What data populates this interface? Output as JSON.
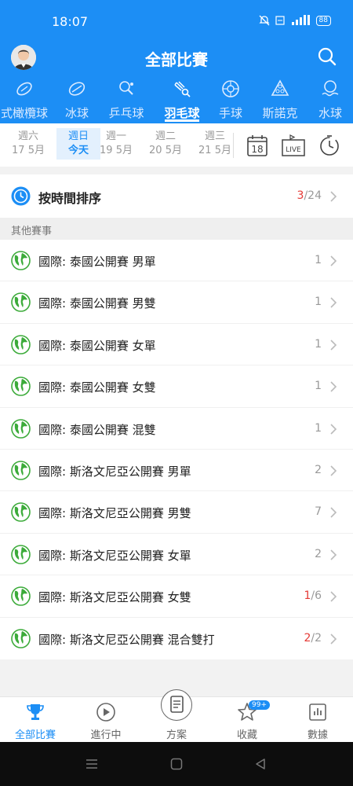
{
  "status_bar": {
    "time": "18:07",
    "battery": "88"
  },
  "header": {
    "title": "全部比賽"
  },
  "sport_tabs": [
    {
      "label": "式橄欖球",
      "icon": "rugby-ball-icon",
      "active": false
    },
    {
      "label": "冰球",
      "icon": "hockey-puck-icon",
      "active": false
    },
    {
      "label": "乒乓球",
      "icon": "table-tennis-icon",
      "active": false
    },
    {
      "label": "羽毛球",
      "icon": "badminton-icon",
      "active": true
    },
    {
      "label": "手球",
      "icon": "handball-icon",
      "active": false
    },
    {
      "label": "斯諾克",
      "icon": "snooker-icon",
      "active": false
    },
    {
      "label": "水球",
      "icon": "water-polo-icon",
      "active": false
    }
  ],
  "dates": [
    {
      "top": "週六",
      "bottom": "17 5月",
      "active": false
    },
    {
      "top": "週日",
      "bottom": "今天",
      "active": true
    },
    {
      "top": "週一",
      "bottom": "19 5月",
      "active": false
    },
    {
      "top": "週二",
      "bottom": "20 5月",
      "active": false
    },
    {
      "top": "週三",
      "bottom": "21 5月",
      "active": false
    }
  ],
  "tools": {
    "calendar_day": "18",
    "live_label": "LIVE"
  },
  "sort_row": {
    "label": "按時間排序",
    "count_highlight": "3",
    "count_rest": "/24"
  },
  "section": {
    "title": "其他賽事"
  },
  "leagues": [
    {
      "name": "國際: 泰國公開賽 男單",
      "count_highlight": "",
      "count_rest": "1"
    },
    {
      "name": "國際: 泰國公開賽 男雙",
      "count_highlight": "",
      "count_rest": "1"
    },
    {
      "name": "國際: 泰國公開賽 女單",
      "count_highlight": "",
      "count_rest": "1"
    },
    {
      "name": "國際: 泰國公開賽 女雙",
      "count_highlight": "",
      "count_rest": "1"
    },
    {
      "name": "國際: 泰國公開賽 混雙",
      "count_highlight": "",
      "count_rest": "1"
    },
    {
      "name": "國際: 斯洛文尼亞公開賽 男單",
      "count_highlight": "",
      "count_rest": "2"
    },
    {
      "name": "國際: 斯洛文尼亞公開賽 男雙",
      "count_highlight": "",
      "count_rest": "7"
    },
    {
      "name": "國際: 斯洛文尼亞公開賽 女單",
      "count_highlight": "",
      "count_rest": "2"
    },
    {
      "name": "國際: 斯洛文尼亞公開賽 女雙",
      "count_highlight": "1",
      "count_rest": "/6"
    },
    {
      "name": "國際: 斯洛文尼亞公開賽 混合雙打",
      "count_highlight": "2",
      "count_rest": "/2"
    }
  ],
  "bottom_nav": [
    {
      "label": "全部比賽",
      "icon": "trophy-icon",
      "active": true
    },
    {
      "label": "進行中",
      "icon": "play-icon",
      "active": false
    },
    {
      "label": "方案",
      "icon": "plan-icon",
      "active": false
    },
    {
      "label": "收藏",
      "icon": "star-icon",
      "active": false,
      "badge": "99+"
    },
    {
      "label": "數據",
      "icon": "chart-icon",
      "active": false
    }
  ],
  "colors": {
    "brand": "#1c8ef5",
    "highlight": "#e53935",
    "globe": "#3cab3a"
  }
}
